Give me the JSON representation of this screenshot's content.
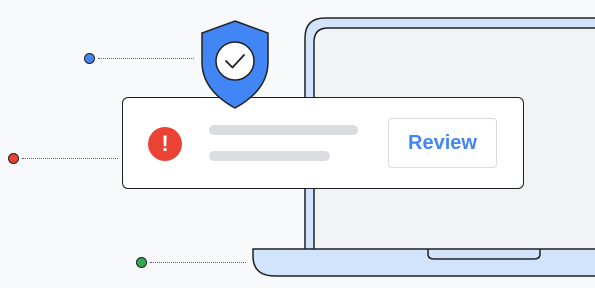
{
  "alert": {
    "icon": "exclamation-icon",
    "icon_glyph": "!",
    "review_label": "Review"
  },
  "shield": {
    "icon": "shield-check-icon"
  },
  "colors": {
    "background": "#f8f9fa",
    "laptop_fill": "#d2e3fc",
    "laptop_screen": "#f1f3f4",
    "shield_blue": "#4285f4",
    "alert_red": "#ea4335",
    "button_text_blue": "#4285f4",
    "dot_blue": "#4285f4",
    "dot_red": "#ea4335",
    "dot_green": "#34a853",
    "outline": "#202124"
  }
}
